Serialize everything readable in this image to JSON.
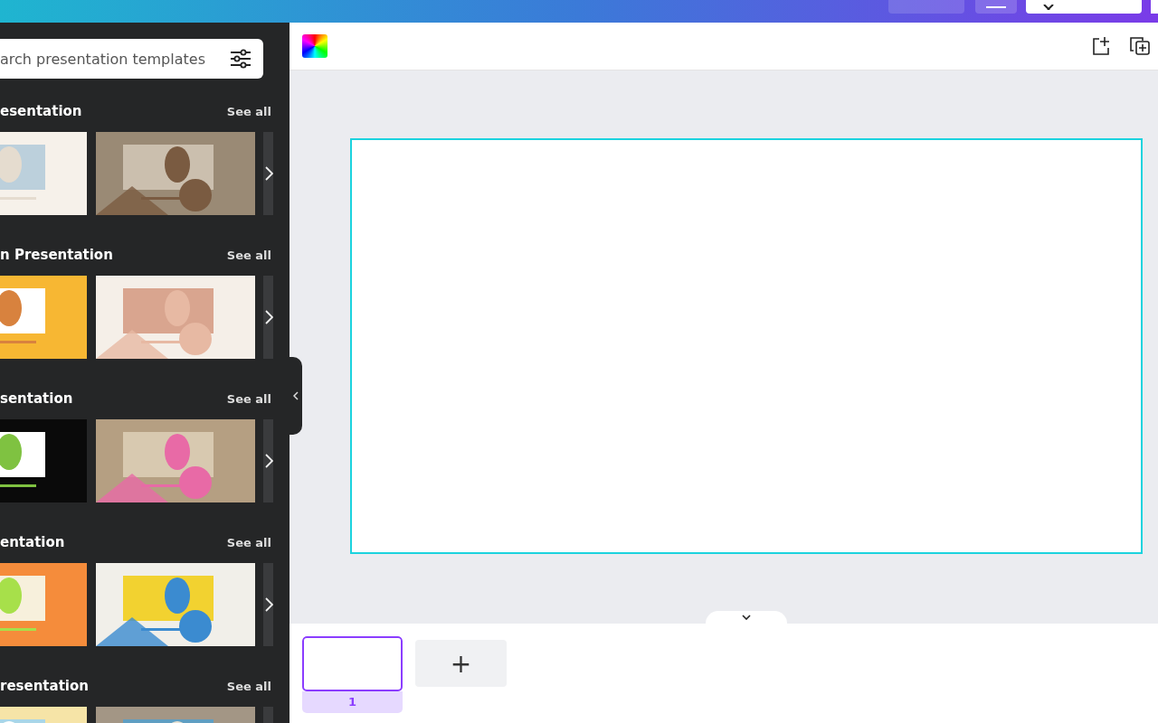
{
  "search": {
    "placeholder": "arch presentation templates"
  },
  "sections": [
    {
      "title": "esentation",
      "see_all": "See all"
    },
    {
      "title": "n Presentation",
      "see_all": "See all"
    },
    {
      "title": "sentation",
      "see_all": "See all"
    },
    {
      "title": "entation",
      "see_all": "See all"
    },
    {
      "title": "resentation",
      "see_all": "See all"
    }
  ],
  "pages": [
    {
      "number": "1",
      "selected": true
    }
  ],
  "add_page": "+"
}
